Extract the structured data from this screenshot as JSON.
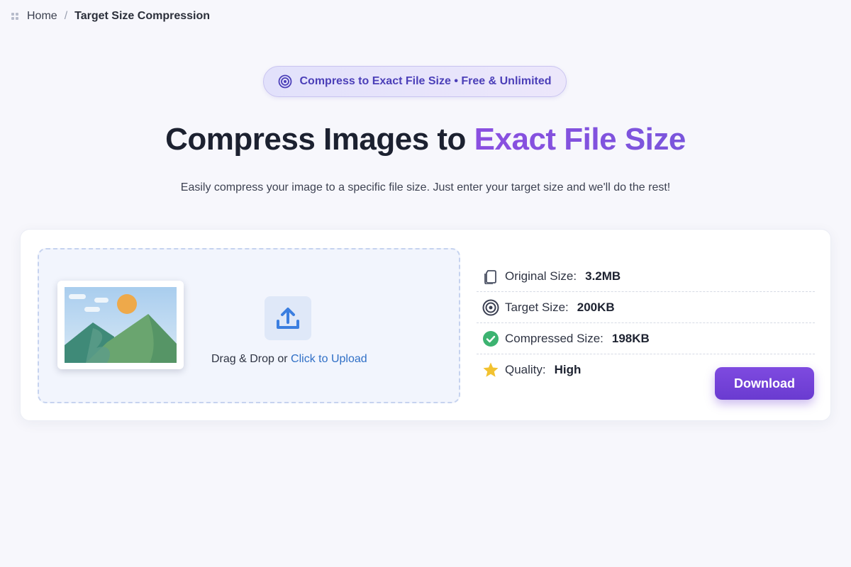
{
  "breadcrumb": {
    "home": "Home",
    "separator": "/",
    "current": "Target Size Compression"
  },
  "badge": {
    "icon": "target-icon",
    "text": "Compress to Exact File Size • Free & Unlimited"
  },
  "hero": {
    "title_main": "Compress Images to ",
    "title_accent": "Exact File Size",
    "subtitle": "Easily compress your image to a specific file size. Just enter your target size and we'll do the rest!"
  },
  "upload": {
    "prompt": "Drag & Drop or ",
    "link": "Click to Upload"
  },
  "info": {
    "original": {
      "icon": "file-icon",
      "label": "Original Size:",
      "value": "3.2MB"
    },
    "target": {
      "icon": "target-icon",
      "label": "Target Size:",
      "value": "200KB"
    },
    "compressed": {
      "icon": "check-circle-icon",
      "label": "Compressed Size:",
      "value": "198KB"
    },
    "quality": {
      "icon": "star-icon",
      "label": "Quality:",
      "value": "High"
    }
  },
  "actions": {
    "download": "Download"
  },
  "colors": {
    "accent": "#7e4ae0",
    "link": "#2f6fc6",
    "success": "#3cb371",
    "star": "#f2c230"
  }
}
